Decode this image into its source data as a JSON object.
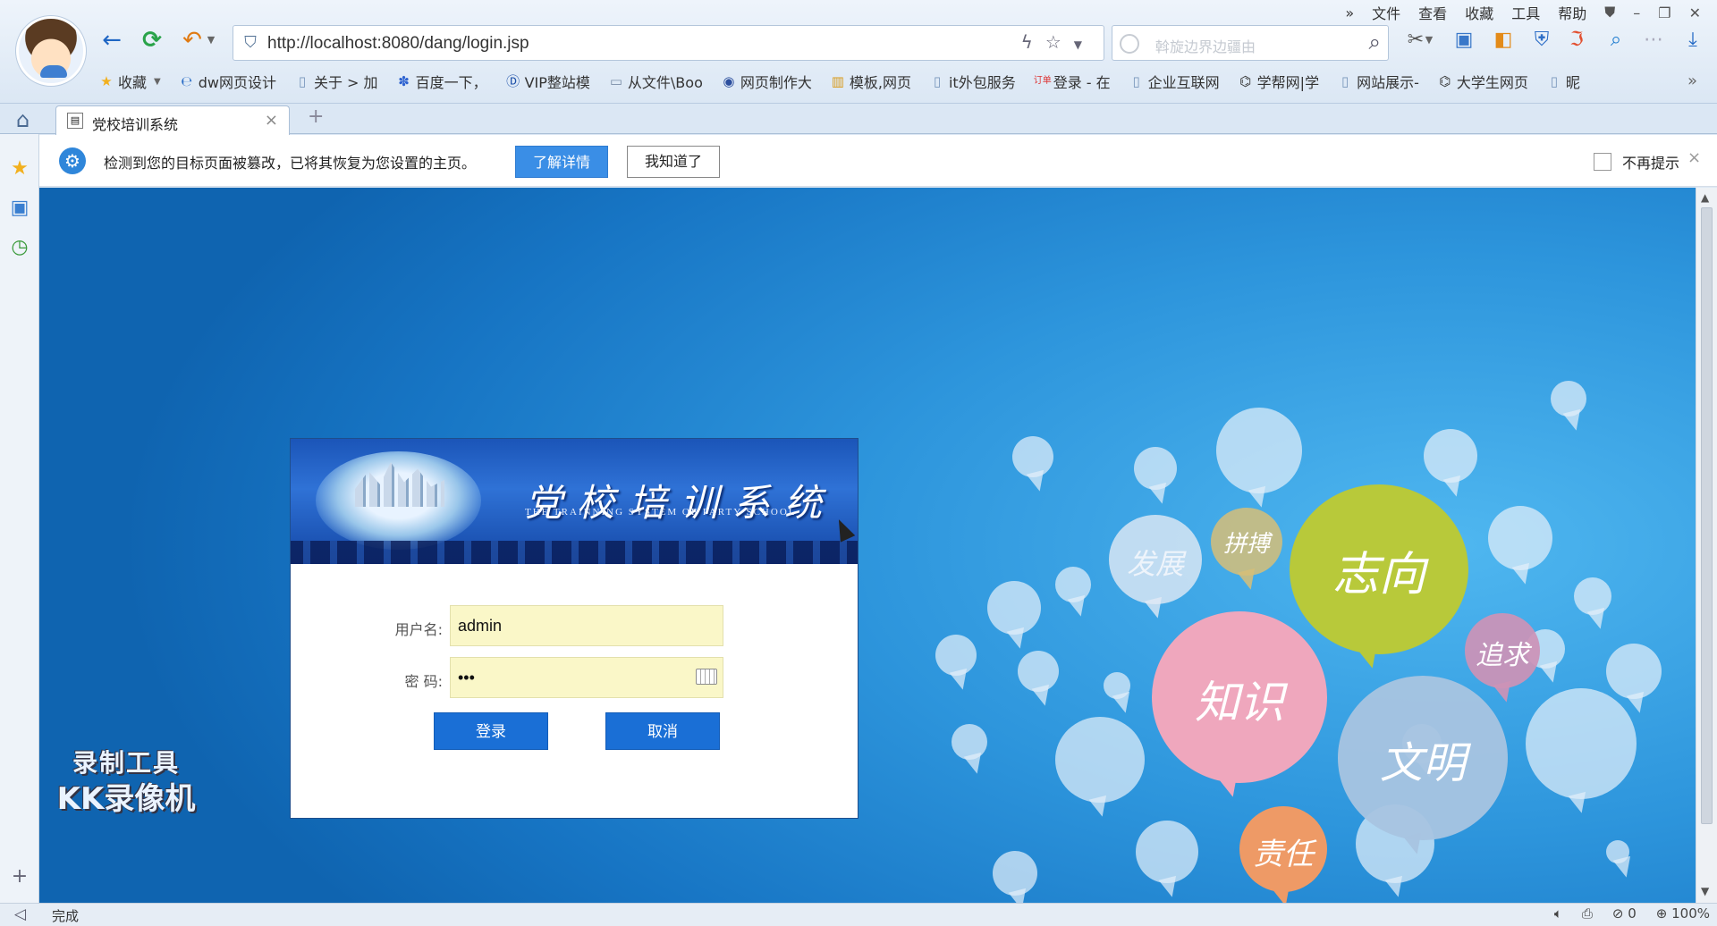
{
  "menu": {
    "overflow": "»",
    "items": [
      "文件",
      "查看",
      "收藏",
      "工具",
      "帮助"
    ]
  },
  "address": {
    "url": "http://localhost:8080/dang/login.jsp",
    "search_placeholder": "斡旋边界边疆由"
  },
  "bookmarks": {
    "items": [
      {
        "label": "收藏",
        "icon": "star-icon"
      },
      {
        "label": "dw网页设计",
        "icon": "ie-icon"
      },
      {
        "label": "关于 > 加",
        "icon": "page-icon"
      },
      {
        "label": "百度一下，",
        "icon": "baidu-icon"
      },
      {
        "label": "VIP整站模",
        "icon": "vip-icon"
      },
      {
        "label": "从文件\\Boo",
        "icon": "folder-icon"
      },
      {
        "label": "网页制作大",
        "icon": "globe-icon"
      },
      {
        "label": "模板,网页",
        "icon": "template-icon"
      },
      {
        "label": "it外包服务",
        "icon": "page-icon"
      },
      {
        "label": "登录 - 在",
        "icon": "login-icon"
      },
      {
        "label": "企业互联网",
        "icon": "page-icon"
      },
      {
        "label": "学帮网|学",
        "icon": "hat-icon"
      },
      {
        "label": "网站展示-",
        "icon": "page-icon"
      },
      {
        "label": "大学生网页",
        "icon": "hat-icon"
      },
      {
        "label": "昵",
        "icon": "page-icon"
      }
    ],
    "more": "»"
  },
  "tab": {
    "title": "党校培训系统",
    "close": "×",
    "new": "+"
  },
  "notification": {
    "text": "检测到您的目标页面被篡改，已将其恢复为您设置的主页。",
    "detail_button": "了解详情",
    "ok_button": "我知道了",
    "no_remind": "不再提示",
    "close": "×"
  },
  "login": {
    "banner_title": "党校培训系统",
    "banner_subtitle": "THE TRAINNING SYSTEM OF PARTY SCHOOL",
    "username_label": "用户名:",
    "username_value": "admin",
    "password_label": "密 码:",
    "password_value": "•••",
    "login_button": "登录",
    "cancel_button": "取消"
  },
  "bubbles": [
    "志向",
    "知识",
    "文明",
    "责任",
    "追求",
    "拼搏",
    "发展"
  ],
  "watermark": {
    "line1": "录制工具",
    "line2": "KK录像机"
  },
  "status": {
    "text": "完成",
    "counter": "0",
    "zoom": "100%"
  },
  "colors": {
    "accent": "#1a6fd6",
    "input_bg": "#faf7c8",
    "content_blue": "#2d95dc"
  }
}
